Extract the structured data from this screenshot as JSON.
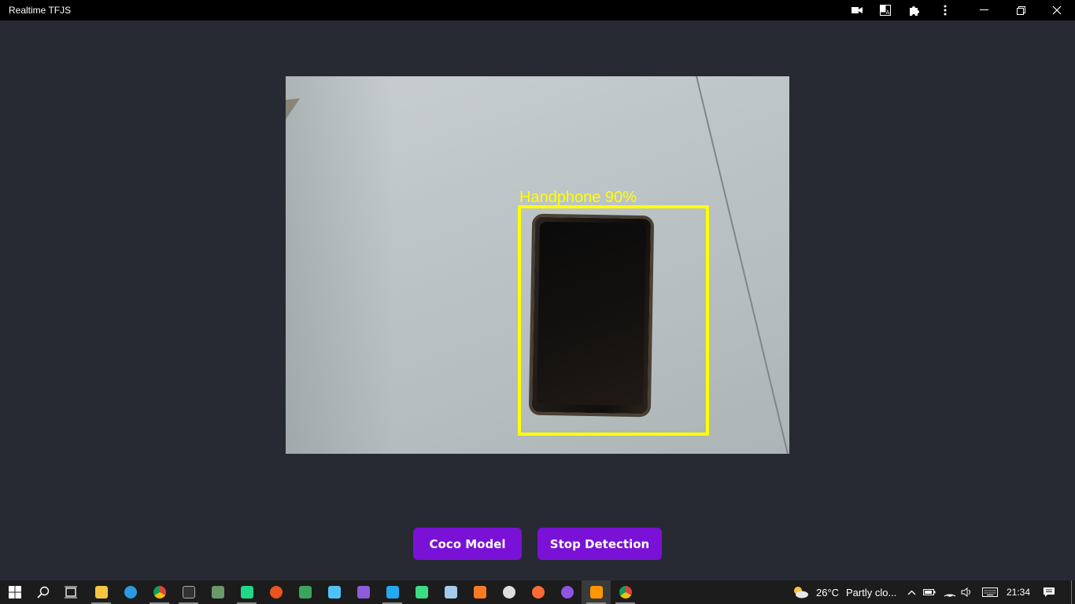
{
  "window": {
    "title": "Realtime TFJS"
  },
  "detection": {
    "label": "Handphone 90%"
  },
  "buttons": {
    "coco_model": "Coco Model",
    "stop_detection": "Stop Detection"
  },
  "titlebar_icons": [
    "camera-icon",
    "translate-icon",
    "extensions-icon",
    "more-menu-icon",
    "minimize-icon",
    "restore-icon",
    "close-icon"
  ],
  "taskbar": {
    "apps": [
      {
        "name": "start-icon"
      },
      {
        "name": "search-icon"
      },
      {
        "name": "task-view-icon"
      },
      {
        "name": "file-explorer-icon",
        "color": "#f5c542"
      },
      {
        "name": "edge-icon",
        "color": "#2a9be0"
      },
      {
        "name": "chrome-icon",
        "color": "#e8b823"
      },
      {
        "name": "terminal-icon",
        "color": "#444444"
      },
      {
        "name": "remote-icon",
        "color": "#6a9a6a"
      },
      {
        "name": "pycharm-icon",
        "color": "#21d789"
      },
      {
        "name": "ubuntu-icon",
        "color": "#e95420"
      },
      {
        "name": "app-icon",
        "color": "#3aa55d"
      },
      {
        "name": "cube-app-icon",
        "color": "#4fc3f7"
      },
      {
        "name": "visual-studio-icon",
        "color": "#8e5cd9"
      },
      {
        "name": "vscode-icon",
        "color": "#23a9f2"
      },
      {
        "name": "android-studio-icon",
        "color": "#3ddc84"
      },
      {
        "name": "virtualbox-icon",
        "color": "#a4cbeb"
      },
      {
        "name": "xampp-icon",
        "color": "#fb7a24"
      },
      {
        "name": "paint-icon",
        "color": "#dddddd"
      },
      {
        "name": "compass-icon",
        "color": "#ff6b35"
      },
      {
        "name": "github-icon",
        "color": "#8e55e3"
      },
      {
        "name": "sublime-icon",
        "color": "#ff9800"
      },
      {
        "name": "chrome-icon",
        "color": "#e8b823"
      }
    ],
    "weather": {
      "temp": "26°C",
      "desc": "Partly clo..."
    },
    "time": "21:34"
  },
  "colors": {
    "accent": "#7a11d6",
    "bbox": "#ffff00",
    "background": "#272a33"
  }
}
